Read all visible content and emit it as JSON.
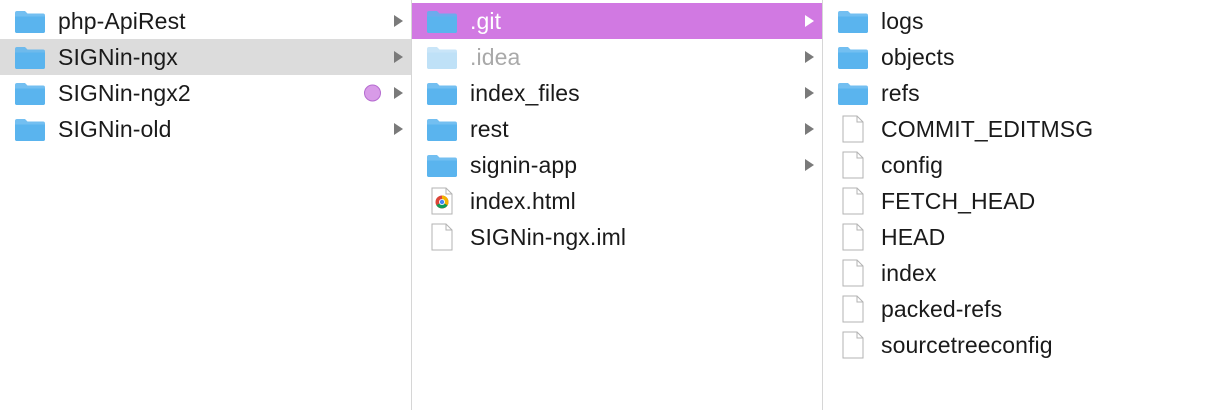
{
  "columns": [
    {
      "items": [
        {
          "name": "php-ApiRest",
          "type": "folder",
          "has_children": true
        },
        {
          "name": "SIGNin-ngx",
          "type": "folder",
          "has_children": true,
          "selected": "grey"
        },
        {
          "name": "SIGNin-ngx2",
          "type": "folder",
          "has_children": true,
          "tag_color": "#d89be8"
        },
        {
          "name": "SIGNin-old",
          "type": "folder",
          "has_children": true
        }
      ]
    },
    {
      "items": [
        {
          "name": ".git",
          "type": "folder",
          "has_children": true,
          "selected": "purple"
        },
        {
          "name": ".idea",
          "type": "folder-dim",
          "has_children": true,
          "dim": true
        },
        {
          "name": "index_files",
          "type": "folder",
          "has_children": true
        },
        {
          "name": "rest",
          "type": "folder",
          "has_children": true
        },
        {
          "name": "signin-app",
          "type": "folder",
          "has_children": true
        },
        {
          "name": "index.html",
          "type": "chrome-file",
          "has_children": false
        },
        {
          "name": "SIGNin-ngx.iml",
          "type": "file",
          "has_children": false
        }
      ]
    },
    {
      "items": [
        {
          "name": "logs",
          "type": "folder",
          "has_children": false
        },
        {
          "name": "objects",
          "type": "folder",
          "has_children": false
        },
        {
          "name": "refs",
          "type": "folder",
          "has_children": false
        },
        {
          "name": "COMMIT_EDITMSG",
          "type": "file",
          "has_children": false
        },
        {
          "name": "config",
          "type": "file",
          "has_children": false
        },
        {
          "name": "FETCH_HEAD",
          "type": "file",
          "has_children": false
        },
        {
          "name": "HEAD",
          "type": "file",
          "has_children": false
        },
        {
          "name": "index",
          "type": "file",
          "has_children": false
        },
        {
          "name": "packed-refs",
          "type": "file",
          "has_children": false
        },
        {
          "name": "sourcetreeconfig",
          "type": "file",
          "has_children": false
        }
      ]
    }
  ],
  "colors": {
    "folder": "#5ab4ee",
    "folder_dim": "#bfe1f7",
    "selection_active": "#d179e2",
    "selection_inactive": "#dcdcdc"
  }
}
